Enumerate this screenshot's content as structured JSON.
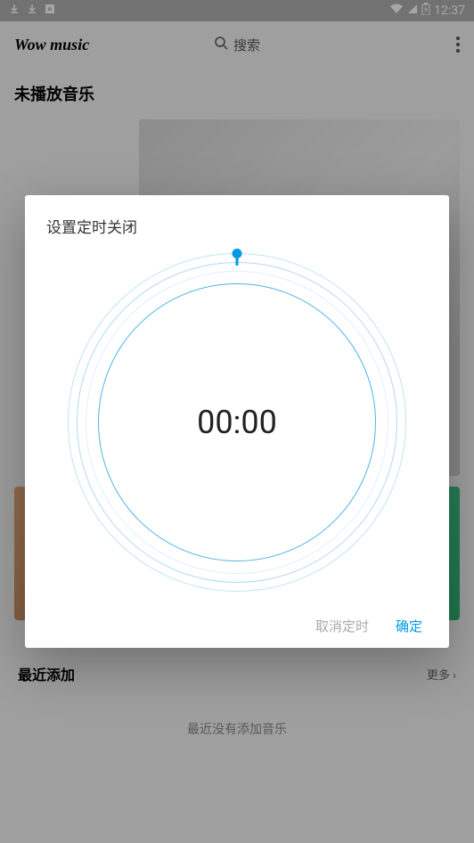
{
  "status_bar": {
    "time": "12:37"
  },
  "app_bar": {
    "title": "Wow music",
    "search_label": "搜索"
  },
  "main": {
    "not_playing_title": "未播放音乐",
    "recent_title": "最近添加",
    "more_label": "更多",
    "no_recent_music": "最近没有添加音乐"
  },
  "dialog": {
    "title": "设置定时关闭",
    "timer_value": "00:00",
    "cancel_label": "取消定时",
    "confirm_label": "确定"
  }
}
